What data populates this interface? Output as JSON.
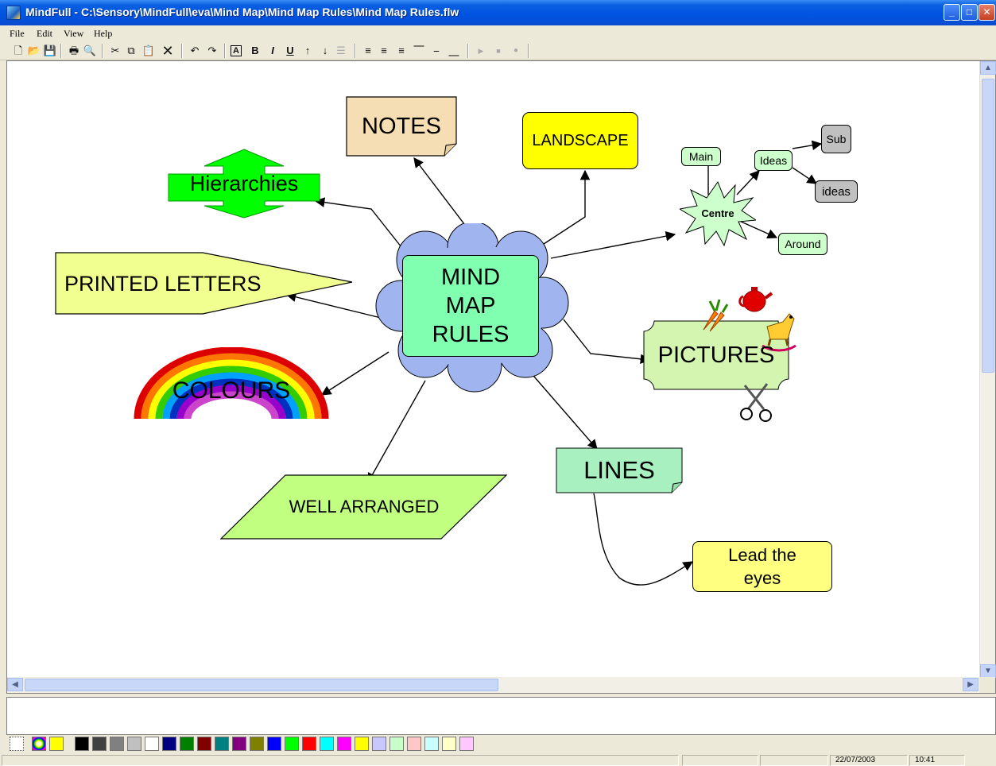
{
  "window": {
    "title": "MindFull - C:\\Sensory\\MindFull\\eva\\Mind Map\\Mind Map Rules\\Mind Map Rules.flw",
    "minimize_glyph": "_",
    "maximize_glyph": "□",
    "close_glyph": "✕"
  },
  "menu": {
    "file": "File",
    "edit": "Edit",
    "view": "View",
    "help": "Help"
  },
  "toolbar": {
    "new": "🗋",
    "open": "📂",
    "save": "💾",
    "print": "🖶",
    "preview": "🔍",
    "cut": "✂",
    "copy": "⧉",
    "paste": "📋",
    "delete": "✕",
    "undo": "↶",
    "redo": "↷",
    "textbox": "A",
    "bold": "B",
    "italic": "I",
    "underline": "U",
    "up": "↑",
    "down": "↓",
    "list": "☰",
    "align_left": "≡",
    "align_center": "≡",
    "align_right": "≡",
    "align_top": "⎺",
    "align_middle": "⎯",
    "align_bottom": "⎽",
    "play": "▶",
    "stop": "■",
    "record": "●"
  },
  "map": {
    "center": {
      "line1": "MIND",
      "line2": "MAP",
      "line3": "RULES",
      "fill": "#80ffb0",
      "cloud": "#a0b4f0"
    },
    "nodes": {
      "notes": "NOTES",
      "landscape": "LANDSCAPE",
      "hierarchies": "Hierarchies",
      "printed_letters": "PRINTED LETTERS",
      "colours": "COLOURS",
      "well_arranged": "WELL ARRANGED",
      "lines": "LINES",
      "lead_line1": "Lead the",
      "lead_line2": "eyes",
      "pictures": "PICTURES",
      "centre": "Centre",
      "main": "Main",
      "ideas_box": "Ideas",
      "sub": "Sub",
      "ideas_small": "ideas",
      "around": "Around"
    },
    "colors": {
      "notes": "#f5deb3",
      "landscape": "#ffff00",
      "hierarchies": "#00ff00",
      "printed_letters": "#f0ff90",
      "well_arranged": "#c0ff80",
      "lines": "#a8f0c0",
      "lead": "#ffff80",
      "pictures": "#d4f5b0",
      "centre": "#ccffcc",
      "small_green": "#ccffcc",
      "small_grey": "#c0c0c0"
    }
  },
  "palette": {
    "colors": [
      "#000000",
      "#404040",
      "#808080",
      "#c0c0c0",
      "#ffffff",
      "#000080",
      "#008000",
      "#800000",
      "#008080",
      "#800080",
      "#808000",
      "#0000ff",
      "#00ff00",
      "#ff0000",
      "#00ffff",
      "#ff00ff",
      "#ffff00",
      "#c8c8ff",
      "#c8ffc8",
      "#ffc8c8",
      "#c8ffff",
      "#ffffc8",
      "#ffc8ff"
    ]
  },
  "status": {
    "date": "22/07/2003",
    "time": "10:41"
  }
}
